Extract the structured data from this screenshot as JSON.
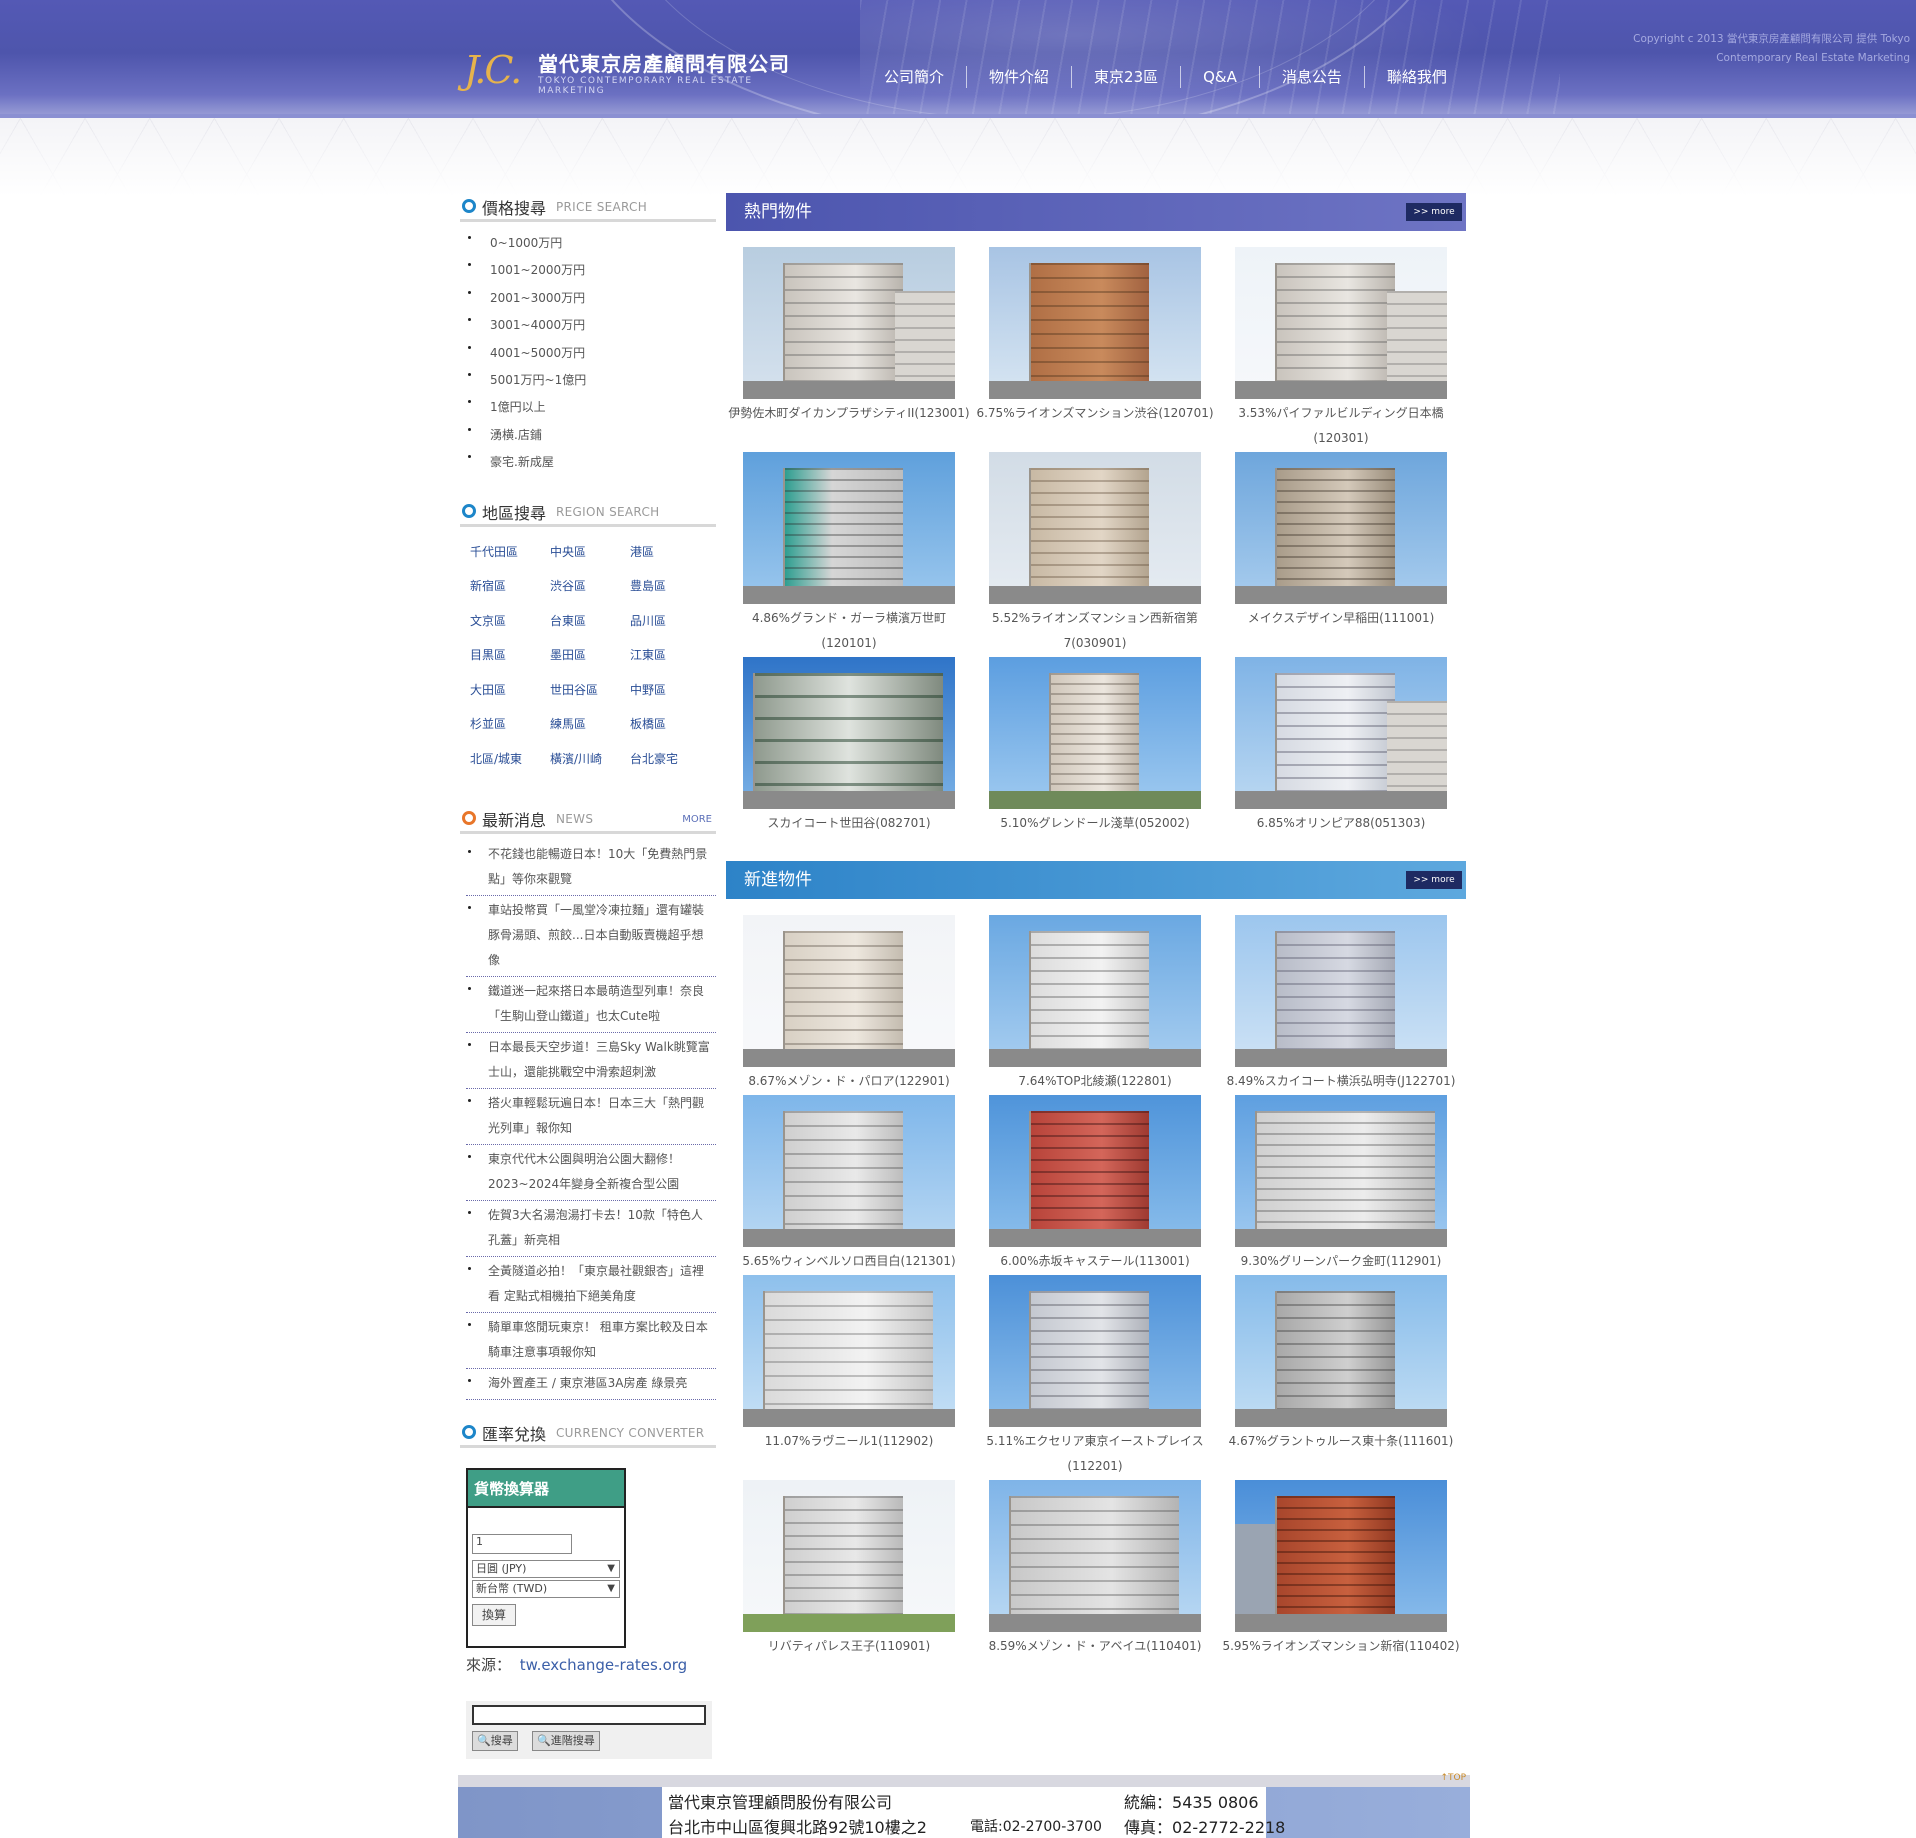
{
  "header": {
    "logo_mark": "J.C.",
    "logo_name": "當代東京房產顧問有限公司",
    "logo_sub": "TOKYO CONTEMPORARY REAL ESTATE MARKETING",
    "copy_line1": "Copyright c 2013 當代東京房產顧問有限公司 提供 Tokyo",
    "copy_line2": "Contemporary Real Estate Marketing",
    "nav": [
      "公司簡介",
      "物件介紹",
      "東京23區",
      "Q&A",
      "消息公告",
      "聯絡我們"
    ]
  },
  "price_search": {
    "title": "價格搜尋",
    "title_en": "PRICE SEARCH",
    "items": [
      "0~1000万円",
      "1001~2000万円",
      "2001~3000万円",
      "3001~4000万円",
      "4001~5000万円",
      "5001万円~1億円",
      "1億円以上",
      "湧横.店鋪",
      "豪宅.新成屋"
    ]
  },
  "region_search": {
    "title": "地區搜尋",
    "title_en": "REGION SEARCH",
    "items": [
      "千代田區",
      "中央區",
      "港區",
      "新宿區",
      "渋谷區",
      "豊島區",
      "文京區",
      "台東區",
      "品川區",
      "目黒區",
      "墨田區",
      "江東區",
      "大田區",
      "世田谷區",
      "中野區",
      "杉並區",
      "練馬區",
      "板橋區",
      "北區/城東",
      "橫濱/川崎",
      "台北豪宅"
    ]
  },
  "news": {
    "title": "最新消息",
    "title_en": "NEWS",
    "more": "MORE",
    "items": [
      "不花錢也能暢遊日本！10大「免費熱門景點」等你來觀覽",
      "車站投幣買「一風堂冷凍拉麵」還有罐裝豚骨湯頭、煎餃...日本自動販賣機超乎想像",
      "鐵道迷一起來搭日本最萌造型列車！奈良「生駒山登山鐵道」也太Cute啦",
      "日本最長天空步道！三島Sky Walk眺覽富士山，還能挑戰空中滑索超刺激",
      "搭火車輕鬆玩遍日本！日本三大「熱門觀光列車」報你知",
      "東京代代木公園與明治公園大翻修！2023~2024年變身全新複合型公園",
      "佐賀3大名湯泡湯打卡去！10款「特色人孔蓋」新亮相",
      "全黃隧道必拍！「東京最社觀銀杏」這裡看 定點式相機拍下絕美角度",
      "騎單車悠閒玩東京！ 租車方案比較及日本騎車注意事項報你知",
      "海外置產王 / 東京港區3A房產 綠景亮"
    ]
  },
  "currency": {
    "title": "匯率兌換",
    "title_en": "CURRENCY CONVERTER",
    "box_title": "貨幣換算器",
    "amount": "1",
    "from": "日圓 (JPY)",
    "to": "新台幣 (TWD)",
    "button": "換算",
    "source_label": "來源：",
    "source_link": "tw.exchange-rates.org"
  },
  "search": {
    "btn1": "搜尋",
    "btn2": "進階搜尋"
  },
  "hot": {
    "title": "熱門物件",
    "more": ">> more",
    "items": [
      "伊勢佐木町ダイカンプラザシティII(123001)",
      "6.75%ライオンズマンション渋谷(120701)",
      "3.53%パイファルビルディング日本橋(120301)",
      "4.86%グランド・ガーラ横濱万世町(120101)",
      "5.52%ライオンズマンション西新宿第7(030901)",
      "メイクスデザイン早稲田(111001)",
      "スカイコート世田谷(082701)",
      "5.10%グレンドール淺草(052002)",
      "6.85%オリンピア88(051303)"
    ]
  },
  "new": {
    "title": "新進物件",
    "more": ">> more",
    "items": [
      "8.67%メゾン・ド・パロア(122901)",
      "7.64%TOP北綾瀬(122801)",
      "8.49%スカイコート横浜弘明寺(J122701)",
      "5.65%ウィンベルソロ西目白(121301)",
      "6.00%赤坂キャステール(113001)",
      "9.30%グリーンパーク金町(112901)",
      "11.07%ラヴニール1(112902)",
      "5.11%エクセリア東京イーストプレイス(112201)",
      "4.67%グラントゥルース東十条(111601)",
      "リバティパレス王子(110901)",
      "8.59%メゾン・ド・アベイユ(110401)",
      "5.95%ライオンズマンション新宿(110402)"
    ]
  },
  "footer": {
    "top": "TOP",
    "company": "當代東京管理顧問股份有限公司",
    "address": "台北市中山區復興北路92號10樓之2",
    "tax_label": "統編：",
    "tax": "5435 0806",
    "tel": "電話:02-2700-3700",
    "fax_label": "傳真：",
    "fax": "02-2772-2218"
  }
}
